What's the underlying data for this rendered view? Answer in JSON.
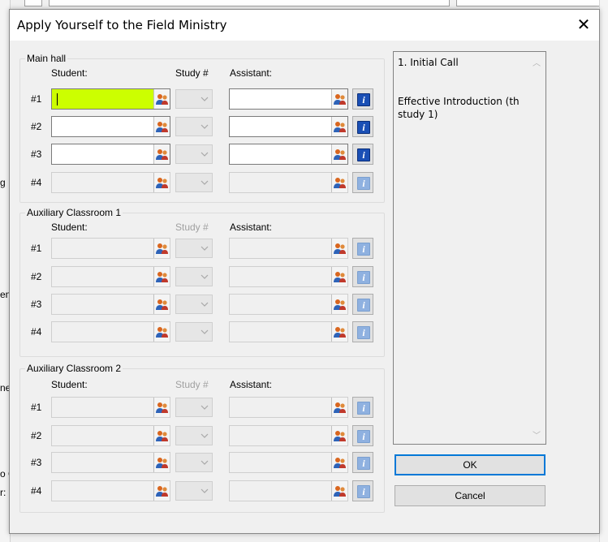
{
  "dialog": {
    "title": "Apply Yourself to the Field Ministry",
    "close_glyph": "✕",
    "columns": {
      "student": "Student:",
      "study": "Study #",
      "assistant": "Assistant:"
    },
    "groups": [
      {
        "label": "Main hall",
        "rows": [
          {
            "num": "#1",
            "student_value": "",
            "enabled": true,
            "highlight": true
          },
          {
            "num": "#2",
            "student_value": "",
            "enabled": true
          },
          {
            "num": "#3",
            "student_value": "",
            "enabled": true
          },
          {
            "num": "#4",
            "student_value": "",
            "enabled": false
          }
        ]
      },
      {
        "label": "Auxiliary Classroom 1",
        "rows": [
          {
            "num": "#1",
            "enabled": false
          },
          {
            "num": "#2",
            "enabled": false
          },
          {
            "num": "#3",
            "enabled": false
          },
          {
            "num": "#4",
            "enabled": false
          }
        ]
      },
      {
        "label": "Auxiliary Classroom 2",
        "rows": [
          {
            "num": "#1",
            "enabled": false
          },
          {
            "num": "#2",
            "enabled": false
          },
          {
            "num": "#3",
            "enabled": false
          },
          {
            "num": "#4",
            "enabled": false
          }
        ]
      }
    ],
    "info_panel": {
      "line1": "1. Initial Call",
      "line2": "Effective Introduction (th study 1)"
    },
    "ok_label": "OK",
    "cancel_label": "Cancel"
  },
  "background": {
    "left_fragments": [
      "g",
      "en",
      "ne",
      "o C",
      "r:"
    ]
  },
  "colors": {
    "highlight": "#ccff00",
    "info_on": "#1a4fb5",
    "info_off": "#8fb1e0",
    "default_border": "#0078d7"
  },
  "icons": {
    "person": "people-icon",
    "info": "info-icon",
    "dropdown": "chevron-down-icon",
    "close": "close-icon"
  }
}
